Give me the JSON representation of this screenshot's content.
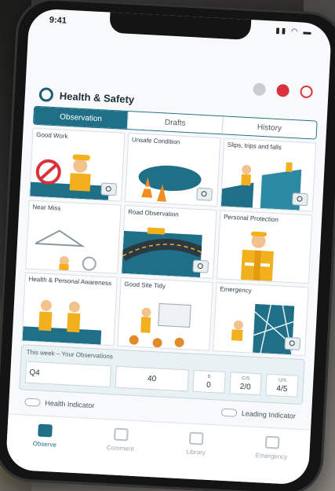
{
  "app": {
    "title": "Health & Safety"
  },
  "status_bar": {
    "time": "9:41"
  },
  "tabs": [
    {
      "label": "Observation",
      "active": true
    },
    {
      "label": "Drafts",
      "active": false
    },
    {
      "label": "History",
      "active": false
    }
  ],
  "cards": [
    {
      "label": "Good Work",
      "icon": "no-smoking-worker"
    },
    {
      "label": "Unsafe Condition",
      "icon": "traffic-cones"
    },
    {
      "label": "Slips, trips and falls",
      "icon": "falling-worker"
    },
    {
      "label": "Near Miss",
      "icon": "hanger"
    },
    {
      "label": "Road Observation",
      "icon": "road-truck"
    },
    {
      "label": "Personal Protection",
      "icon": "safety-vest-worker"
    },
    {
      "label": "Health & Personal Awareness",
      "icon": "coworkers"
    },
    {
      "label": "Good Site Tidy",
      "icon": "presentation-worker"
    },
    {
      "label": "Emergency",
      "icon": "glass-pattern"
    }
  ],
  "stats": {
    "header": "This week – Your Observations",
    "period": "Q4",
    "count": "40",
    "items": [
      {
        "label": "B",
        "value": "0"
      },
      {
        "label": "C/S",
        "value": "2/0"
      },
      {
        "label": "U/S",
        "value": "4/5"
      }
    ]
  },
  "toggles": [
    {
      "label": "Health Indicator"
    },
    {
      "label": "Leading Indicator"
    }
  ],
  "nav": [
    {
      "label": "Observe",
      "active": true
    },
    {
      "label": "Comment",
      "active": false
    },
    {
      "label": "Library",
      "active": false
    },
    {
      "label": "Emergency",
      "active": false
    }
  ],
  "colors": {
    "primary": "#1f6f86",
    "alert": "#d9323c"
  }
}
